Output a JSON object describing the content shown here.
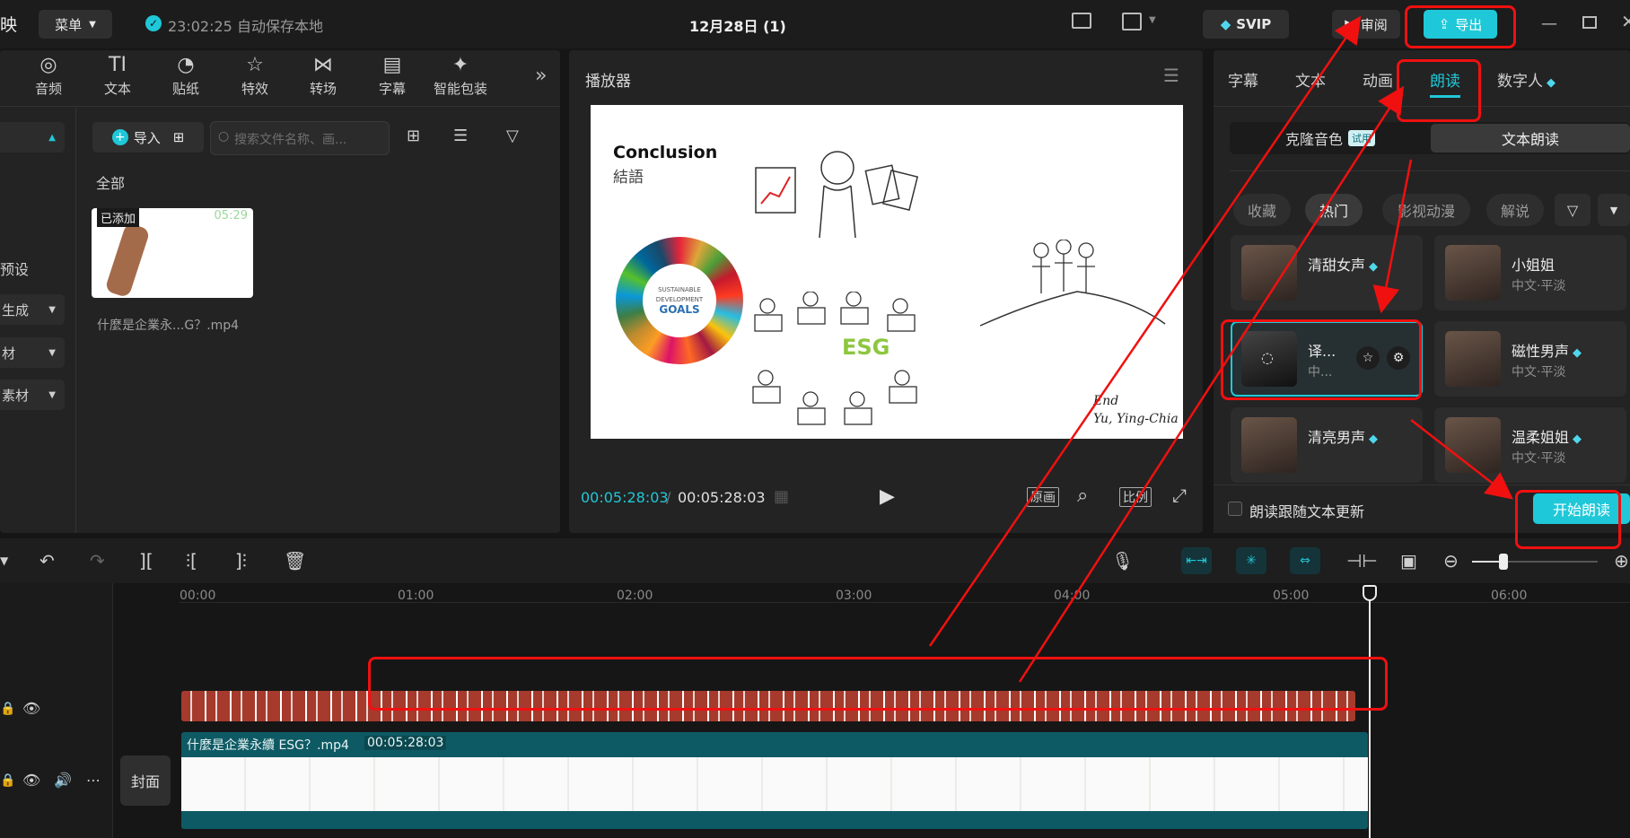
{
  "topbar": {
    "app_char": "映",
    "menu": "菜单",
    "autosave": "23:02:25 自动保存本地",
    "title": "12月28日 (1)",
    "svip": "SVIP",
    "review": "审阅",
    "export": "导出"
  },
  "toolbar": [
    {
      "label": "音频",
      "icon": "audio-icon"
    },
    {
      "label": "文本",
      "icon": "text-icon"
    },
    {
      "label": "贴纸",
      "icon": "sticker-icon"
    },
    {
      "label": "特效",
      "icon": "effects-icon"
    },
    {
      "label": "转场",
      "icon": "transition-icon"
    },
    {
      "label": "字幕",
      "icon": "subtitle-icon"
    },
    {
      "label": "智能包装",
      "icon": "smart-pack-icon"
    }
  ],
  "media": {
    "import": "导入",
    "search_placeholder": "搜索文件名称、画...",
    "all": "全部",
    "clip_badge": "已添加",
    "clip_duration": "05:29",
    "clip_name": "什麼是企業永...G？.mp4"
  },
  "sidebar": [
    "预设",
    "生成",
    "材",
    "素材"
  ],
  "player": {
    "title": "播放器",
    "current": "00:05:28:03",
    "total": "00:05:28:03",
    "original": "原画",
    "ratio": "比例"
  },
  "slide": {
    "heading": "Conclusion",
    "subheading": "結語",
    "esg": "ESG",
    "sdg1": "SUSTAINABLE",
    "sdg2": "DEVELOPMENT",
    "sdg3": "GOALS",
    "sign1": "End",
    "sign2": "Yu, Ying-Chia"
  },
  "right": {
    "tabs": [
      "字幕",
      "文本",
      "动画",
      "朗读",
      "数字人"
    ],
    "subtabs": {
      "clone": "克隆音色",
      "trial": "试用",
      "tts": "文本朗读"
    },
    "chips": [
      "收藏",
      "热门",
      "影视动漫",
      "解说"
    ],
    "voices": [
      {
        "name": "清甜女声",
        "sub": "",
        "vip": true
      },
      {
        "name": "小姐姐",
        "sub": "中文·平淡",
        "vip": false
      },
      {
        "name": "译...",
        "sub": "中...",
        "vip": false
      },
      {
        "name": "磁性男声",
        "sub": "中文·平淡",
        "vip": true
      },
      {
        "name": "清亮男声",
        "sub": "",
        "vip": true
      },
      {
        "name": "温柔姐姐",
        "sub": "中文·平淡",
        "vip": true
      }
    ],
    "follow": "朗读跟随文本更新",
    "start": "开始朗读"
  },
  "timeline": {
    "ruler": [
      "00:00",
      "01:00",
      "02:00",
      "03:00",
      "04:00",
      "05:00",
      "06:00"
    ],
    "clip_title": "什麼是企業永續 ESG？.mp4",
    "clip_time": "00:05:28:03",
    "cover": "封面"
  },
  "colors": {
    "accent": "#1fc8d8",
    "annotation": "#f01010",
    "audio_clip": "#a63a2c",
    "video_track": "#0e5a64"
  }
}
